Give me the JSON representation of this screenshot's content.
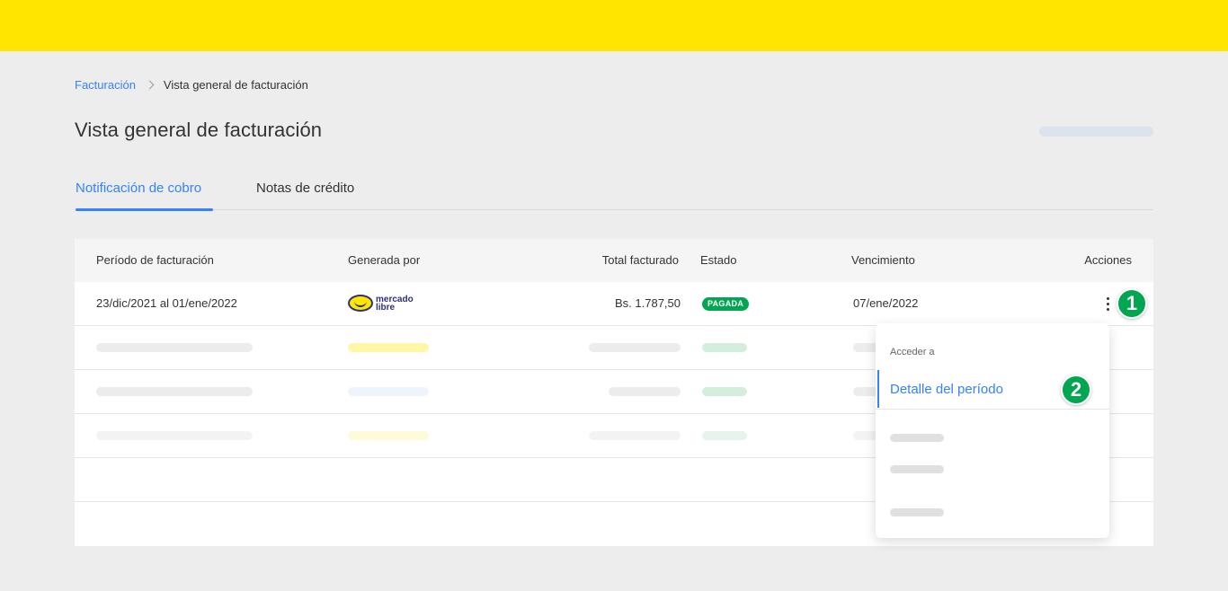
{
  "breadcrumb": {
    "link": "Facturación",
    "current": "Vista general de facturación"
  },
  "page": {
    "title": "Vista general de facturación"
  },
  "tabs": [
    {
      "label": "Notificación de cobro",
      "active": true
    },
    {
      "label": "Notas de crédito",
      "active": false
    }
  ],
  "table": {
    "headers": {
      "period": "Período de facturación",
      "generated_by": "Generada por",
      "total": "Total facturado",
      "status": "Estado",
      "due": "Vencimiento",
      "actions": "Acciones"
    },
    "rows": [
      {
        "period": "23/dic/2021 al 01/ene/2022",
        "logo_line1": "mercado",
        "logo_line2": "libre",
        "total": "Bs. 1.787,50",
        "status": "PAGADA",
        "due": "07/ene/2022"
      }
    ]
  },
  "steps": {
    "one": "1",
    "two": "2"
  },
  "dropdown": {
    "label": "Acceder a",
    "item": "Detalle del período"
  },
  "colors": {
    "brand_yellow": "#ffe600",
    "accent_blue": "#3483fa",
    "status_green": "#00a650",
    "logo_navy": "#2d3277"
  },
  "icons": [
    "chevron-right-icon",
    "more-vertical-icon",
    "mercado-libre-logo"
  ]
}
